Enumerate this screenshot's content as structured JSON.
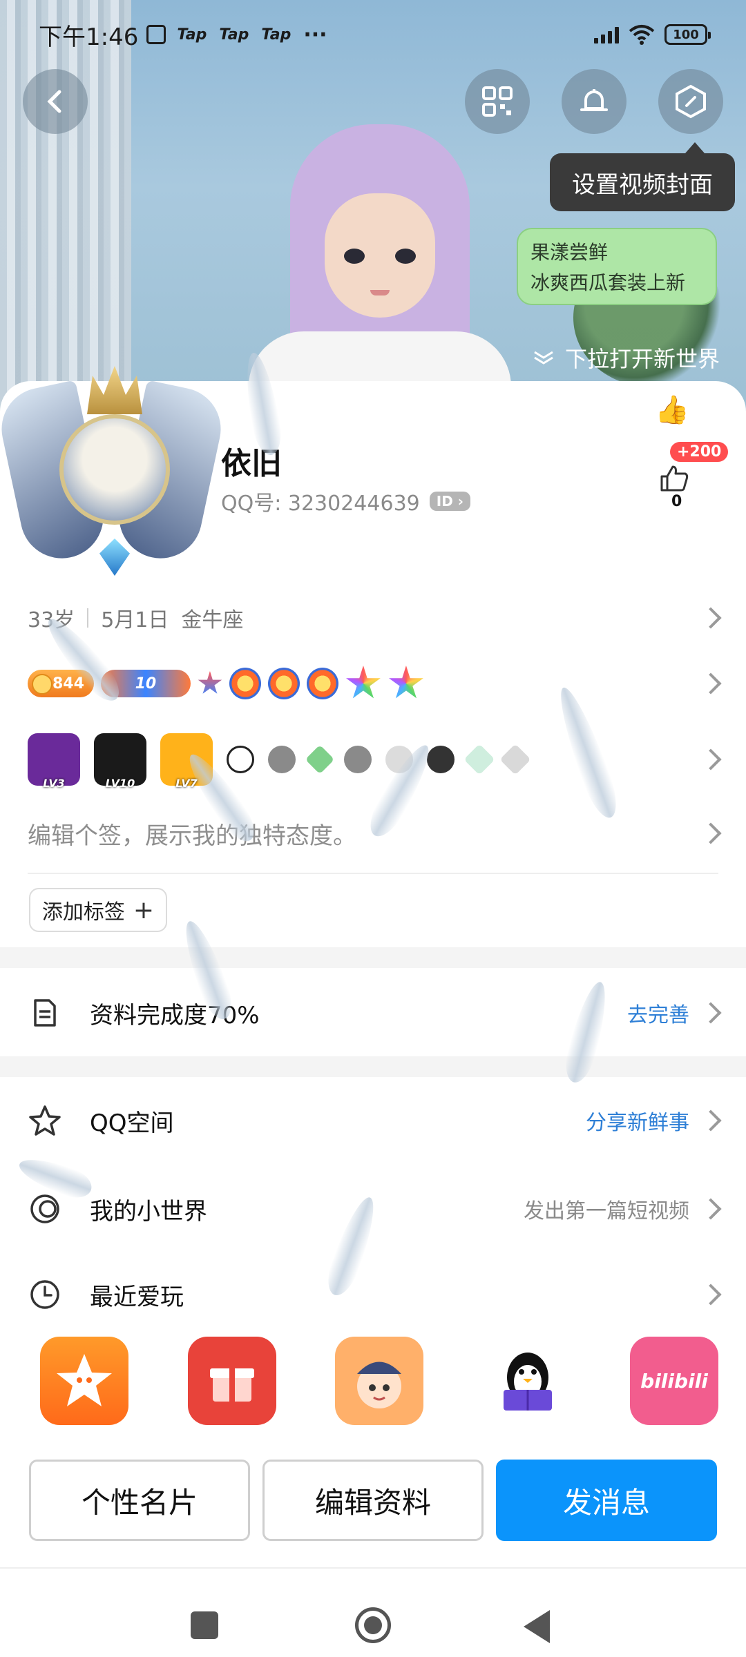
{
  "status_bar": {
    "time": "下午1:46",
    "extra_icons": [
      "Tap",
      "Tap",
      "Tap"
    ],
    "more": "···",
    "battery": "100"
  },
  "header": {
    "back_icon": "back-arrow-icon",
    "qr_icon": "qr-code-icon",
    "bell_icon": "bell-icon",
    "cover_icon": "cover-settings-icon",
    "tooltip": "设置视频封面"
  },
  "bubble": {
    "line1": "果漾尝鲜",
    "line2": "冰爽西瓜套装上新"
  },
  "pull_hint": "下拉打开新世界",
  "profile": {
    "nickname": "依旧",
    "qq_label": "QQ号: 3230244639",
    "id_badge": "ID",
    "like_plus": "+200",
    "like_count": "0"
  },
  "info": {
    "age": "33岁",
    "birthday": "5月1日",
    "zodiac": "金牛座"
  },
  "badges": {
    "coin_value": "844",
    "level_value": "10"
  },
  "game_badges": [
    {
      "label": "LV3",
      "color": "#6a2a9a"
    },
    {
      "label": "LV10",
      "color": "#1a1a1a"
    },
    {
      "label": "LV7",
      "color": "#ffb21a"
    }
  ],
  "signature": "编辑个签，展示我的独特态度。",
  "add_tag": "添加标签",
  "completion": {
    "label": "资料完成度70%",
    "action": "去完善"
  },
  "menu": [
    {
      "label": "QQ空间",
      "right": "分享新鲜事",
      "icon": "qzone-star-icon"
    },
    {
      "label": "我的小世界",
      "right": "发出第一篇短视频",
      "icon": "small-world-icon"
    },
    {
      "label": "最近爱玩",
      "right": "",
      "icon": "clock-icon"
    }
  ],
  "apps": [
    {
      "name": "star-app-icon",
      "color": "#ff7a1a"
    },
    {
      "name": "gift-app-icon",
      "color": "#e8433a"
    },
    {
      "name": "anime-game-app-icon",
      "color": "#ff8a3a"
    },
    {
      "name": "penguin-reading-app-icon",
      "color": "#ffffff"
    },
    {
      "name": "bilibili-app-icon",
      "color": "#f25d8e",
      "text": "bilibili"
    }
  ],
  "buttons": {
    "card": "个性名片",
    "edit": "编辑资料",
    "message": "发消息"
  },
  "colors": {
    "primary": "#0b94fb",
    "link_blue": "#2e7fd6"
  }
}
